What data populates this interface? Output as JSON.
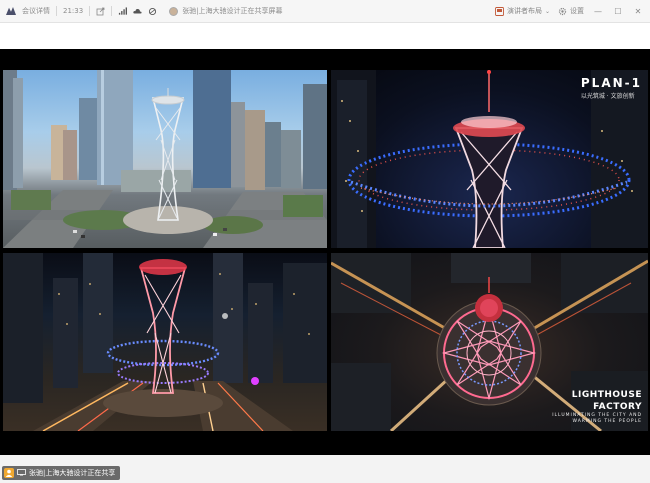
{
  "toolbar": {
    "app_name": "会议详情",
    "time": "21:33",
    "presenter": "张驰|上海大驰设计正在共享屏幕",
    "annotate_label": "演讲者布局",
    "settings_label": "设置"
  },
  "slides": {
    "plan_title": "PLAN-1",
    "plan_subtitle": "以光筑城 · 文旅创新",
    "lighthouse_title_line1": "LIGHTHOUSE",
    "lighthouse_title_line2": "FACTORY",
    "lighthouse_tagline_1": "ILLUMINATING THE CITY AND",
    "lighthouse_tagline_2": "WARMING THE PEOPLE"
  },
  "share_bar": {
    "label": "张驰|上海大驰设计正在共享"
  },
  "colors": {
    "toolbar_bg": "#f6f6f6",
    "stage_bg": "#000000",
    "share_pill_bg": "#6a6a6a",
    "accent_orange": "#f0a830"
  }
}
